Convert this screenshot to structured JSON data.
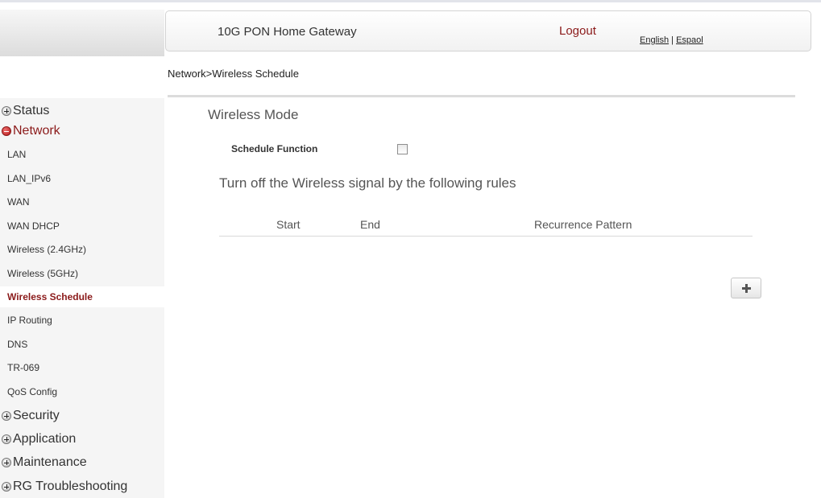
{
  "header": {
    "title": "10G PON Home Gateway",
    "logout": "Logout",
    "lang_english": "English",
    "lang_sep": "|",
    "lang_espanol": "Espaol"
  },
  "breadcrumb": "Network>Wireless Schedule",
  "sidebar": {
    "groups": {
      "status": "Status",
      "network": "Network",
      "security": "Security",
      "application": "Application",
      "maintenance": "Maintenance",
      "rg_troubleshooting": "RG Troubleshooting"
    },
    "network_items": [
      "LAN",
      "LAN_IPv6",
      "WAN",
      "WAN DHCP",
      "Wireless (2.4GHz)",
      "Wireless (5GHz)",
      "Wireless Schedule",
      "IP Routing",
      "DNS",
      "TR-069",
      "QoS Config"
    ],
    "active_item": "Wireless Schedule"
  },
  "main": {
    "section_title": "Wireless Mode",
    "schedule_function_label": "Schedule Function",
    "schedule_function_checked": false,
    "rules_title": "Turn off the Wireless signal by the following rules",
    "table_headers": [
      "Start",
      "End",
      "Recurrence Pattern"
    ],
    "rows": []
  },
  "icons": {
    "add_button": "plus-icon",
    "collapsed_group": "plus-circle-icon",
    "expanded_group": "minus-circle-icon"
  },
  "colors": {
    "accent": "#8b1a1a",
    "sidebar_bg": "#f5f5f5",
    "divider": "#dcdcdc"
  }
}
